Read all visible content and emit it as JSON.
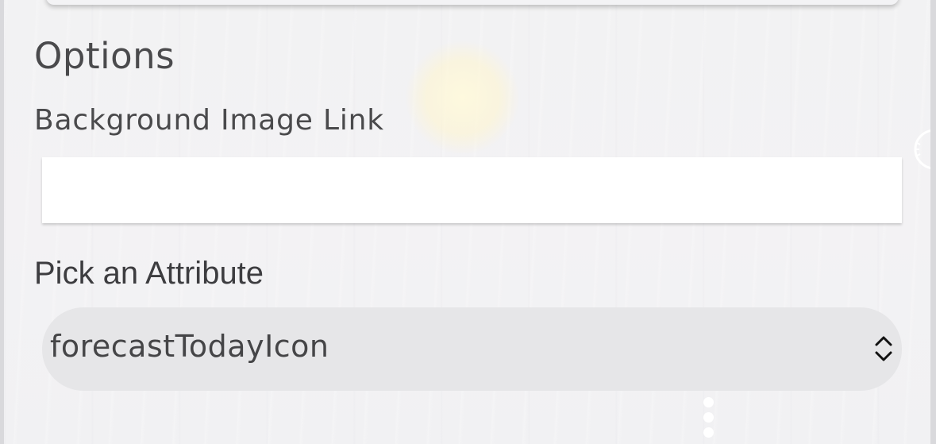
{
  "options": {
    "heading": "Options",
    "background_image": {
      "label": "Background Image Link",
      "value": "",
      "placeholder": ""
    },
    "attribute": {
      "label": "Pick an Attribute",
      "selected": "forecastTodayIcon"
    }
  },
  "icons": {
    "select_chevron": "chevron-up-down-icon",
    "more": "more-vertical-icon",
    "side_handle": "compass-icon"
  },
  "colors": {
    "panel_bg": "#f2f2f3",
    "text": "#4a4a4c",
    "select_bg": "#e6e6e8",
    "input_bg": "#ffffff"
  }
}
